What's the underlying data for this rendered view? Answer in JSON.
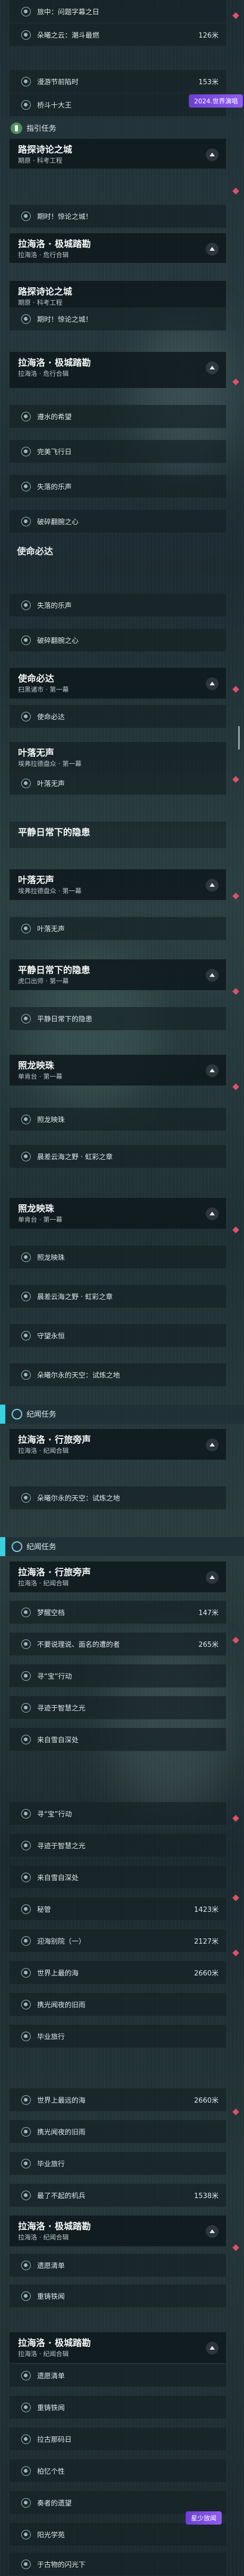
{
  "top_rows": [
    {
      "label": "旅中：问题字幕之日",
      "dist": ""
    },
    {
      "label": "朵曦之云：潮斗最燃",
      "dist": "126米"
    },
    {
      "label": "漫游节前陷时",
      "dist": "153米"
    },
    {
      "label": "桥斗十大王",
      "dist": ""
    }
  ],
  "section_task": {
    "label": "指引任务",
    "badge": "2024.世界演唱"
  },
  "groups": [
    {
      "title": "路探诗论之城",
      "sub": "期原 · 科考工程",
      "rows": []
    },
    {
      "title": "拉海洛 · 极城踏勘",
      "sub": "拉海洛 · 危行合辑",
      "rows": []
    },
    {
      "title": "",
      "sub": "",
      "rows": [
        {
          "label": "期时！惊论之城！"
        }
      ]
    },
    {
      "title": "路探诗论之城",
      "sub": "期原 · 科考工程",
      "rows": [
        {
          "label": "期时！惊论之城！"
        }
      ]
    },
    {
      "title": "拉海洛 · 极城踏勘",
      "sub": "拉海洛 · 危行合辑",
      "rows": [
        {
          "label": "遵水的希望"
        },
        {
          "label": "完美飞行日"
        },
        {
          "label": "失落的乐声"
        },
        {
          "label": "破碎翻腕之心"
        }
      ]
    }
  ],
  "section_must": {
    "label": "使命必达"
  },
  "must_rows": [
    {
      "label": "失落的乐声"
    },
    {
      "label": "破碎翻腕之心"
    }
  ],
  "must_group": {
    "title": "使命必达",
    "sub": "扫黑诸市 · 第一幕",
    "rows": [
      {
        "label": "使命必达"
      }
    ]
  },
  "leaf_group": {
    "title": "叶落无声",
    "sub": "埃弗拉德盘众 · 第一幕",
    "rows": [
      {
        "label": "叶落无声"
      }
    ]
  },
  "calm_title": {
    "title": "平静日常下的隐患"
  },
  "leaf_group2": {
    "title": "叶落无声",
    "sub": "埃弗拉德盘众 · 第一幕",
    "rows": [
      {
        "label": "叶落无声"
      }
    ]
  },
  "calm_group": {
    "title": "平静日常下的隐患",
    "sub": "虎口出师 · 第一幕",
    "rows": [
      {
        "label": "平静日常下的隐患"
      }
    ]
  },
  "shadow_group": {
    "title": "照龙映珠",
    "sub": "单肯台 · 第一幕",
    "rows": [
      {
        "label": "照龙映珠"
      },
      {
        "label": "晨差云海之野 · 虹彩之章"
      }
    ]
  },
  "shadow_group2": {
    "title": "照龙映珠",
    "sub": "单肯台 · 第一幕",
    "rows": [
      {
        "label": "照龙映珠"
      },
      {
        "label": "晨差云海之野 · 虹彩之章"
      },
      {
        "label": "守望永恒"
      },
      {
        "label": "朵曦尔永的天空：试炼之地"
      }
    ]
  },
  "section_jiyu": {
    "label": "纪闻任务"
  },
  "jiyu_group": {
    "title": "拉海洛 · 行旅旁声",
    "sub": "拉海洛 · 纪闻合辑",
    "rows": [
      {
        "label": "朵曦尔永的天空：试炼之地"
      }
    ]
  },
  "section_jiyu2": {
    "label": "纪闻任务"
  },
  "jiyu_group2": {
    "title": "拉海洛 · 行旅旁声",
    "sub": "拉海洛 · 纪闻合辑",
    "rows": [
      {
        "label": "梦醒空档",
        "dist": "147米"
      },
      {
        "label": "不要说理说、面名的遭的者",
        "dist": "265米"
      },
      {
        "label": "寻“宝”行动",
        "dist": ""
      },
      {
        "label": "寻迹于智慧之光",
        "dist": ""
      },
      {
        "label": "来自雪自深处",
        "dist": ""
      }
    ]
  },
  "mid_rows": [
    {
      "label": "寻“宝”行动",
      "dist": ""
    },
    {
      "label": "寻迹于智慧之光",
      "dist": ""
    },
    {
      "label": "来自雪自深处",
      "dist": ""
    },
    {
      "label": "秘管",
      "dist": "1423米"
    },
    {
      "label": "迎海别院（一）",
      "dist": "2127米"
    },
    {
      "label": "世界上最的海",
      "dist": "2660米"
    },
    {
      "label": "携光闻夜的旧雨",
      "dist": ""
    },
    {
      "label": "毕业旅行",
      "dist": ""
    }
  ],
  "mid_rows2": [
    {
      "label": "世界上最远的海",
      "dist": "2660米"
    },
    {
      "label": "携光闻夜的旧雨",
      "dist": ""
    },
    {
      "label": "毕业旅行",
      "dist": ""
    },
    {
      "label": "最了不起的机兵",
      "dist": "1538米"
    }
  ],
  "lahai_group": {
    "title": "拉海洛 · 极城踏勘",
    "sub": "拉海洛 · 纪闻合辑",
    "rows": [
      {
        "label": "遗愿清单"
      },
      {
        "label": "重铸铁闻"
      }
    ]
  },
  "lahai_group2": {
    "title": "拉海洛 · 极城踏勘",
    "sub": "拉海洛 · 纪闻合辑",
    "rows": [
      {
        "label": "遗愿清单"
      },
      {
        "label": "重铸铁闻"
      },
      {
        "label": "拉古那码日"
      },
      {
        "label": "柏忆个性"
      },
      {
        "label": "奏者的遗望"
      },
      {
        "label": "阳光学苑"
      },
      {
        "label": "于古物的闪光下"
      }
    ]
  },
  "bottom_badge": "星少放闻"
}
